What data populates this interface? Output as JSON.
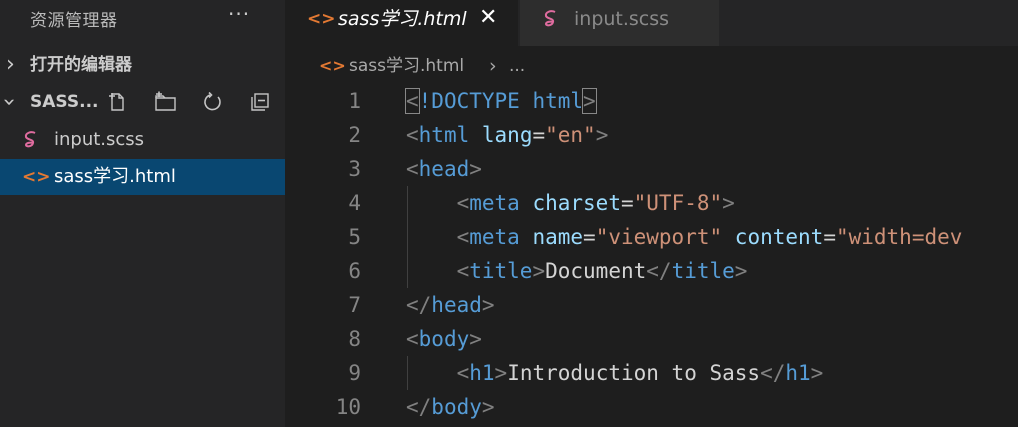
{
  "sidebar": {
    "title": "资源管理器",
    "more": "···",
    "open_editors_label": "打开的编辑器",
    "folder_label": "SASS...",
    "files": [
      {
        "name": "input.scss",
        "icon": "sass-file-icon"
      },
      {
        "name": "sass学习.html",
        "icon": "html-file-icon"
      }
    ]
  },
  "tabs": [
    {
      "label": "sass学习.html",
      "icon": "html-file-icon",
      "close": "✕"
    },
    {
      "label": "input.scss",
      "icon": "sass-file-icon"
    }
  ],
  "breadcrumb": {
    "file": "sass学习.html",
    "separator": "›",
    "more": "..."
  },
  "editor": {
    "lines": [
      {
        "n": "1",
        "tokens": [
          [
            "punc",
            "<"
          ],
          [
            "tag",
            "!DOCTYPE"
          ],
          [
            "txt",
            " "
          ],
          [
            "tag",
            "html"
          ],
          [
            "punc",
            ">"
          ]
        ]
      },
      {
        "n": "2",
        "tokens": [
          [
            "punc",
            "<"
          ],
          [
            "tag",
            "html"
          ],
          [
            "txt",
            " "
          ],
          [
            "attr",
            "lang"
          ],
          [
            "eq",
            "="
          ],
          [
            "str",
            "\"en\""
          ],
          [
            "punc",
            ">"
          ]
        ]
      },
      {
        "n": "3",
        "tokens": [
          [
            "punc",
            "<"
          ],
          [
            "tag",
            "head"
          ],
          [
            "punc",
            ">"
          ]
        ]
      },
      {
        "n": "4",
        "tokens": [
          [
            "txt",
            "    "
          ],
          [
            "punc",
            "<"
          ],
          [
            "tag",
            "meta"
          ],
          [
            "txt",
            " "
          ],
          [
            "attr",
            "charset"
          ],
          [
            "eq",
            "="
          ],
          [
            "str",
            "\"UTF-8\""
          ],
          [
            "punc",
            ">"
          ]
        ]
      },
      {
        "n": "5",
        "tokens": [
          [
            "txt",
            "    "
          ],
          [
            "punc",
            "<"
          ],
          [
            "tag",
            "meta"
          ],
          [
            "txt",
            " "
          ],
          [
            "attr",
            "name"
          ],
          [
            "eq",
            "="
          ],
          [
            "str",
            "\"viewport\""
          ],
          [
            "txt",
            " "
          ],
          [
            "attr",
            "content"
          ],
          [
            "eq",
            "="
          ],
          [
            "str",
            "\"width=dev"
          ]
        ]
      },
      {
        "n": "6",
        "tokens": [
          [
            "txt",
            "    "
          ],
          [
            "punc",
            "<"
          ],
          [
            "tag",
            "title"
          ],
          [
            "punc",
            ">"
          ],
          [
            "txt",
            "Document"
          ],
          [
            "punc",
            "</"
          ],
          [
            "tag",
            "title"
          ],
          [
            "punc",
            ">"
          ]
        ]
      },
      {
        "n": "7",
        "tokens": [
          [
            "punc",
            "</"
          ],
          [
            "tag",
            "head"
          ],
          [
            "punc",
            ">"
          ]
        ]
      },
      {
        "n": "8",
        "tokens": [
          [
            "punc",
            "<"
          ],
          [
            "tag",
            "body"
          ],
          [
            "punc",
            ">"
          ]
        ]
      },
      {
        "n": "9",
        "tokens": [
          [
            "txt",
            "    "
          ],
          [
            "punc",
            "<"
          ],
          [
            "tag",
            "h1"
          ],
          [
            "punc",
            ">"
          ],
          [
            "txt",
            "Introduction to Sass"
          ],
          [
            "punc",
            "</"
          ],
          [
            "tag",
            "h1"
          ],
          [
            "punc",
            ">"
          ]
        ]
      },
      {
        "n": "10",
        "tokens": [
          [
            "punc",
            "</"
          ],
          [
            "tag",
            "body"
          ],
          [
            "punc",
            ">"
          ]
        ]
      }
    ]
  },
  "colors": {
    "sass_pink": "#e06c9f",
    "html_orange": "#e37933",
    "selection": "#094771"
  }
}
